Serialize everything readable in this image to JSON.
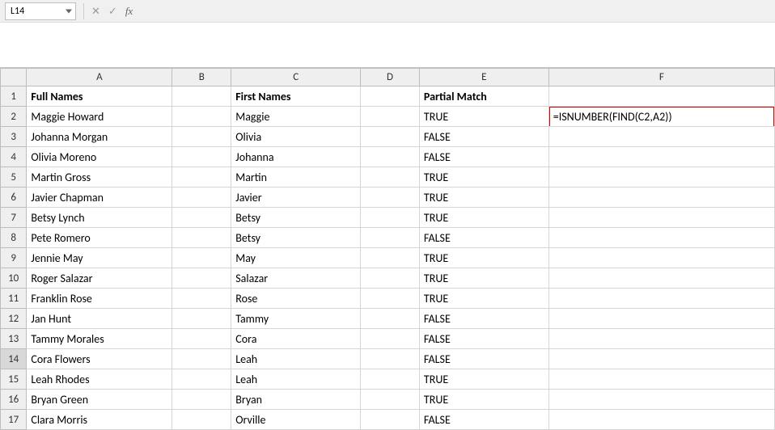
{
  "namebox": {
    "value": "L14"
  },
  "formula_bar": {
    "value": ""
  },
  "fx_icons": {
    "cancel": "✕",
    "confirm": "✓",
    "fx": "fx"
  },
  "headers": {
    "A": "Full Names",
    "C": "First Names",
    "E": "Partial Match"
  },
  "columns": [
    "A",
    "B",
    "C",
    "D",
    "E",
    "F"
  ],
  "highlight_formula": "=ISNUMBER(FIND(C2,A2))",
  "active_row": 14,
  "rows": [
    {
      "n": 2,
      "full": "Maggie Howard",
      "first": "Maggie",
      "match": "TRUE",
      "f": "=ISNUMBER(FIND(C2,A2))"
    },
    {
      "n": 3,
      "full": "Johanna Morgan",
      "first": "Olivia",
      "match": "FALSE",
      "f": ""
    },
    {
      "n": 4,
      "full": "Olivia Moreno",
      "first": "Johanna",
      "match": "FALSE",
      "f": ""
    },
    {
      "n": 5,
      "full": "Martin Gross",
      "first": "Martin",
      "match": "TRUE",
      "f": ""
    },
    {
      "n": 6,
      "full": "Javier Chapman",
      "first": "Javier",
      "match": "TRUE",
      "f": ""
    },
    {
      "n": 7,
      "full": "Betsy Lynch",
      "first": "Betsy",
      "match": "TRUE",
      "f": ""
    },
    {
      "n": 8,
      "full": "Pete Romero",
      "first": "Betsy",
      "match": "FALSE",
      "f": ""
    },
    {
      "n": 9,
      "full": "Jennie May",
      "first": "May",
      "match": "TRUE",
      "f": ""
    },
    {
      "n": 10,
      "full": "Roger Salazar",
      "first": "Salazar",
      "match": "TRUE",
      "f": ""
    },
    {
      "n": 11,
      "full": "Franklin Rose",
      "first": "Rose",
      "match": "TRUE",
      "f": ""
    },
    {
      "n": 12,
      "full": "Jan Hunt",
      "first": "Tammy",
      "match": "FALSE",
      "f": ""
    },
    {
      "n": 13,
      "full": "Tammy Morales",
      "first": "Cora",
      "match": "FALSE",
      "f": ""
    },
    {
      "n": 14,
      "full": "Cora Flowers",
      "first": "Leah",
      "match": "FALSE",
      "f": ""
    },
    {
      "n": 15,
      "full": "Leah Rhodes",
      "first": "Leah",
      "match": "TRUE",
      "f": ""
    },
    {
      "n": 16,
      "full": "Bryan Green",
      "first": "Bryan",
      "match": "TRUE",
      "f": ""
    },
    {
      "n": 17,
      "full": "Clara Morris",
      "first": "Orville",
      "match": "FALSE",
      "f": ""
    }
  ]
}
